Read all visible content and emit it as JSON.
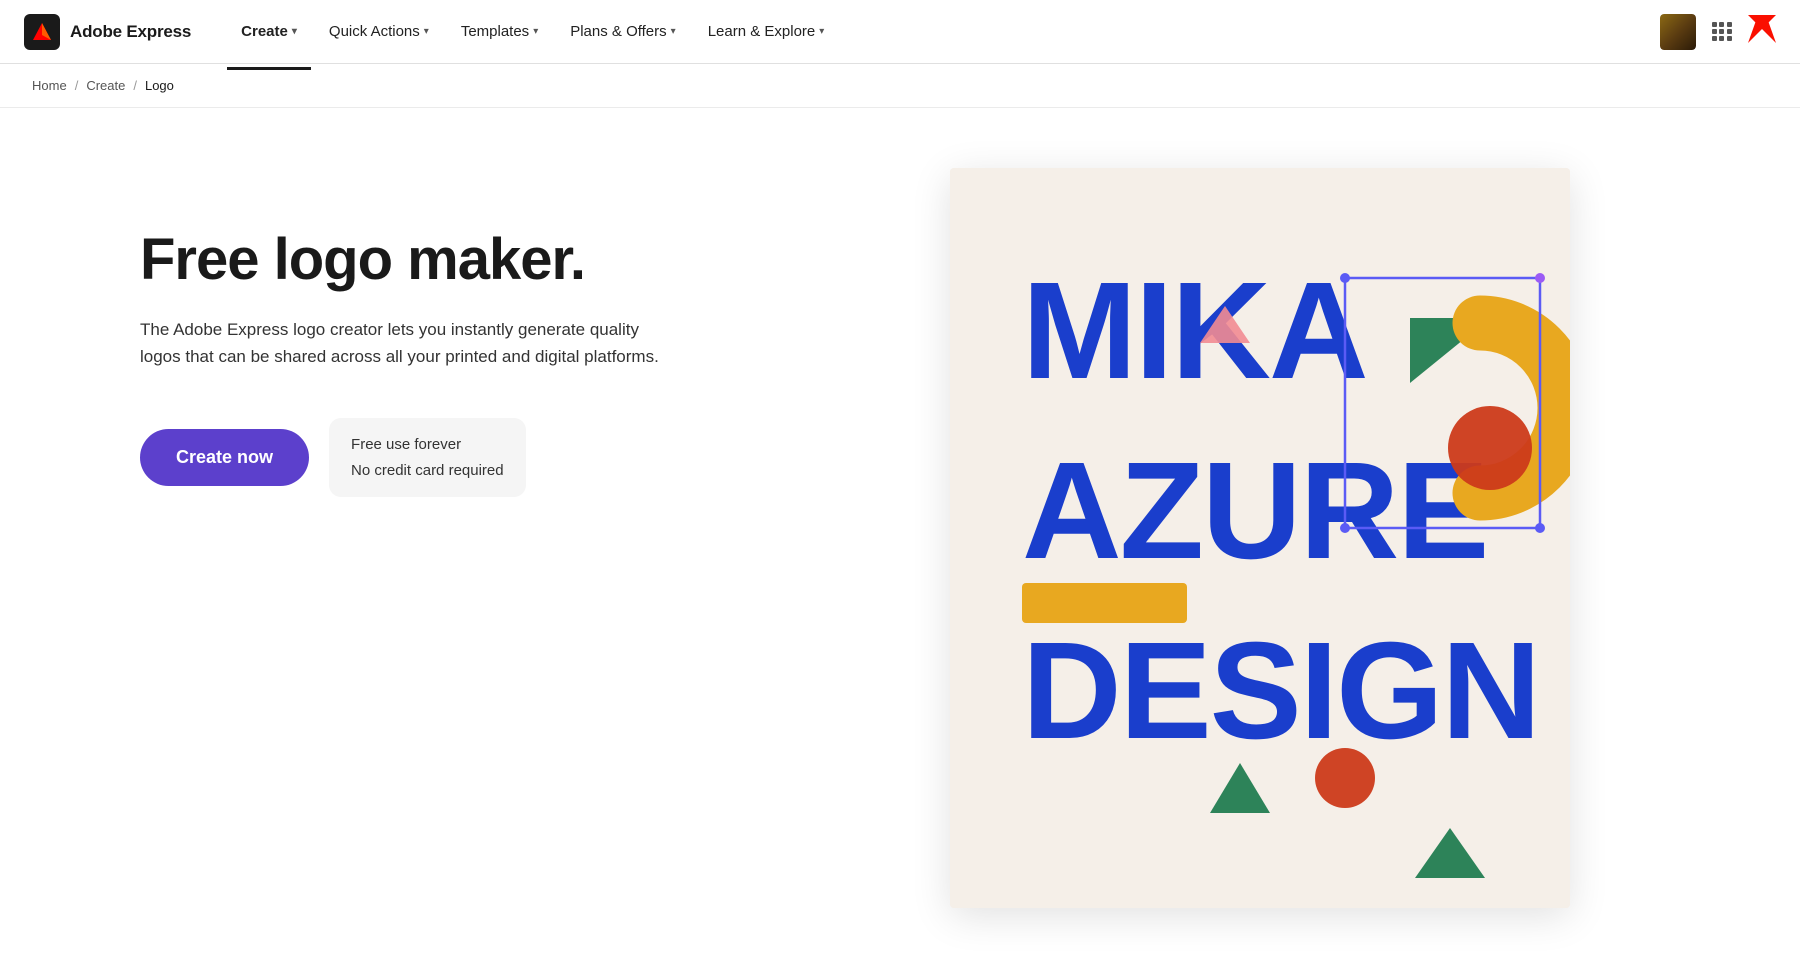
{
  "brand": {
    "name": "Adobe Express",
    "icon_label": "adobe-express-icon"
  },
  "nav": {
    "items": [
      {
        "label": "Create",
        "active": true,
        "has_dropdown": true
      },
      {
        "label": "Quick Actions",
        "active": false,
        "has_dropdown": true
      },
      {
        "label": "Templates",
        "active": false,
        "has_dropdown": true
      },
      {
        "label": "Plans & Offers",
        "active": false,
        "has_dropdown": true
      },
      {
        "label": "Learn & Explore",
        "active": false,
        "has_dropdown": true
      }
    ]
  },
  "breadcrumb": {
    "items": [
      {
        "label": "Home",
        "link": true
      },
      {
        "label": "Create",
        "link": true
      },
      {
        "label": "Logo",
        "link": false
      }
    ]
  },
  "hero": {
    "title": "Free logo maker.",
    "description": "The Adobe Express logo creator lets you instantly generate quality logos that can be shared across all your printed and digital platforms.",
    "cta_label": "Create now",
    "free_note_line1": "Free use forever",
    "free_note_line2": "No credit card required"
  }
}
